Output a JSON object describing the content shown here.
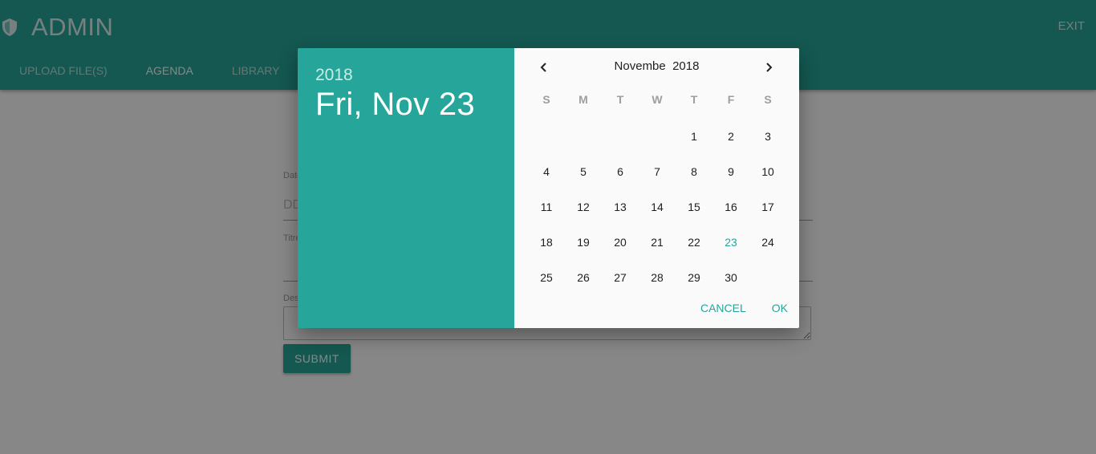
{
  "app": {
    "title": "ADMIN",
    "exit_label": "EXIT",
    "tabs": [
      {
        "label": "UPLOAD FILE(S)"
      },
      {
        "label": "AGENDA"
      },
      {
        "label": "LIBRARY"
      }
    ],
    "accent_color": "#26a69a"
  },
  "form": {
    "date_label": "Date",
    "date_placeholder": "DD",
    "title_label": "Titre",
    "description_label": "Description",
    "submit_label": "SUBMIT"
  },
  "datepicker": {
    "year": "2018",
    "selected_date": "Fri, Nov 23",
    "month_label": "Novembe  2018",
    "weekdays": [
      "S",
      "M",
      "T",
      "W",
      "T",
      "F",
      "S"
    ],
    "weeks": [
      [
        "",
        "",
        "",
        "",
        "1",
        "2",
        "3"
      ],
      [
        "4",
        "5",
        "6",
        "7",
        "8",
        "9",
        "10"
      ],
      [
        "11",
        "12",
        "13",
        "14",
        "15",
        "16",
        "17"
      ],
      [
        "18",
        "19",
        "20",
        "21",
        "22",
        "23",
        "24"
      ],
      [
        "25",
        "26",
        "27",
        "28",
        "29",
        "30",
        ""
      ]
    ],
    "selected_day": "23",
    "cancel_label": "CANCEL",
    "ok_label": "OK",
    "prev_icon": "chevron-left-icon",
    "next_icon": "chevron-right-icon"
  }
}
